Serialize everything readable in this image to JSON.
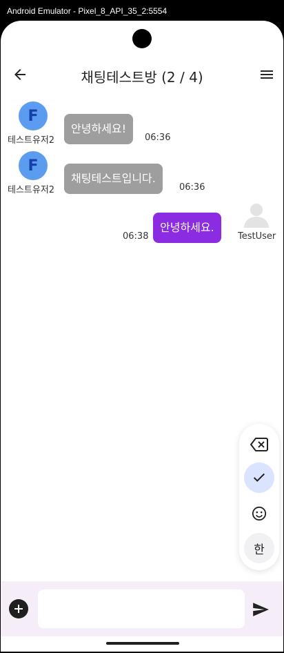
{
  "window": {
    "title": "Android Emulator - Pixel_8_API_35_2:5554"
  },
  "appbar": {
    "title": "채팅테스트방 (2 / 4)"
  },
  "messages": [
    {
      "sender": "테스트유저2",
      "avatar_letter": "F",
      "text": "안녕하세요!",
      "time": "06:36",
      "mine": false
    },
    {
      "sender": "테스트유저2",
      "avatar_letter": "F",
      "text": "채팅테스트입니다.",
      "time": "06:36",
      "mine": false
    },
    {
      "sender": "TestUser",
      "avatar_letter": "",
      "text": "안녕하세요.",
      "time": "06:38",
      "mine": true
    }
  ],
  "keyboard_panel": {
    "hangul_label": "한"
  },
  "input": {
    "value": "",
    "placeholder": ""
  },
  "colors": {
    "my_bubble": "#8b2be2",
    "other_bubble": "#9e9e9e",
    "avatar_bg": "#5b9cf0",
    "avatar_letter": "#1540a8",
    "input_bar": "#f5eef8"
  },
  "icons": [
    "back-arrow-icon",
    "hamburger-menu-icon",
    "backspace-icon",
    "check-icon",
    "emoji-icon",
    "add-circle-icon",
    "send-icon",
    "default-avatar-icon"
  ]
}
